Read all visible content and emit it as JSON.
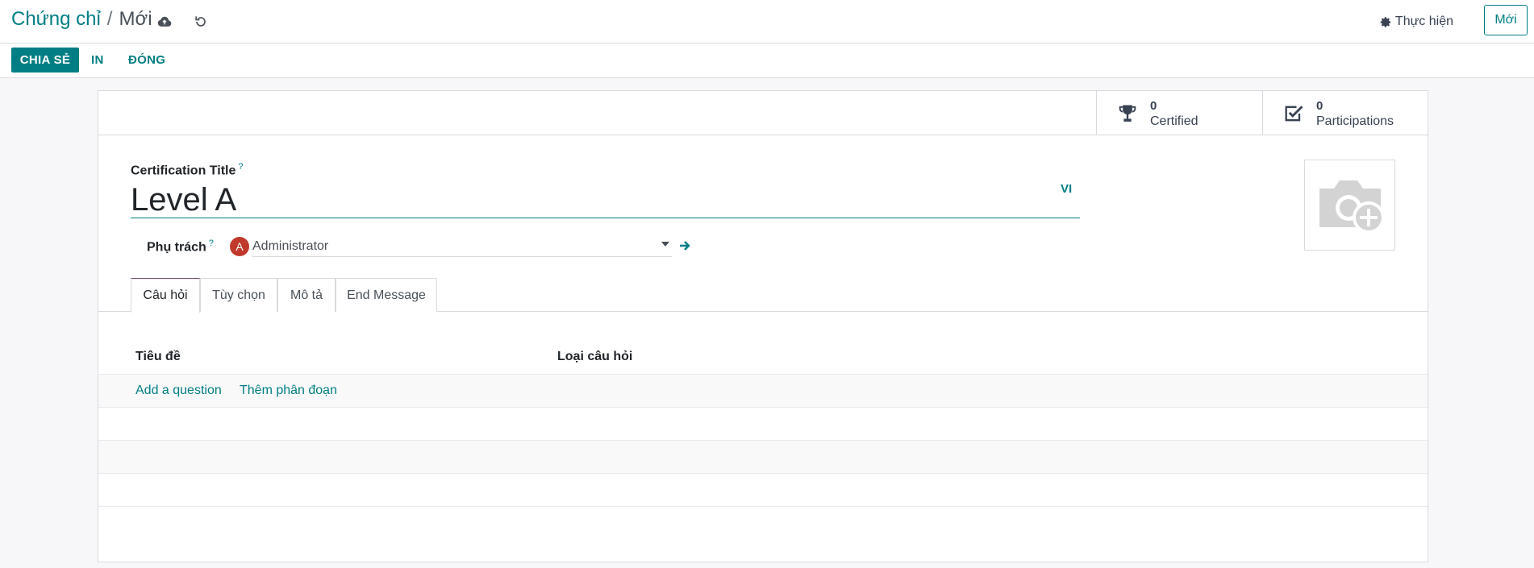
{
  "breadcrumb": {
    "parent": "Chứng chỉ",
    "separator": "/",
    "current": "Mới"
  },
  "topbar": {
    "action_label": "Thực hiện",
    "new_label": "Mới"
  },
  "statusbar": {
    "share": "CHIA SẺ",
    "print": "IN",
    "close": "ĐÓNG"
  },
  "stats": [
    {
      "value": "0",
      "label": "Certified"
    },
    {
      "value": "0",
      "label": "Participations"
    }
  ],
  "form": {
    "title_label": "Certification Title",
    "help_mark": "?",
    "title_value": "Level A",
    "lang": "VI",
    "responsible_label": "Phụ trách",
    "responsible_initial": "A",
    "responsible_value": "Administrator"
  },
  "tabs": [
    "Câu hỏi",
    "Tùy chọn",
    "Mô tả",
    "End Message"
  ],
  "list": {
    "columns": [
      "Tiêu đề",
      "Loại câu hỏi"
    ],
    "add_question": "Add a question",
    "add_section": "Thêm phân đoạn"
  },
  "colors": {
    "accent": "#017e84",
    "tab_active": "#714b67",
    "avatar": "#c0392b"
  }
}
